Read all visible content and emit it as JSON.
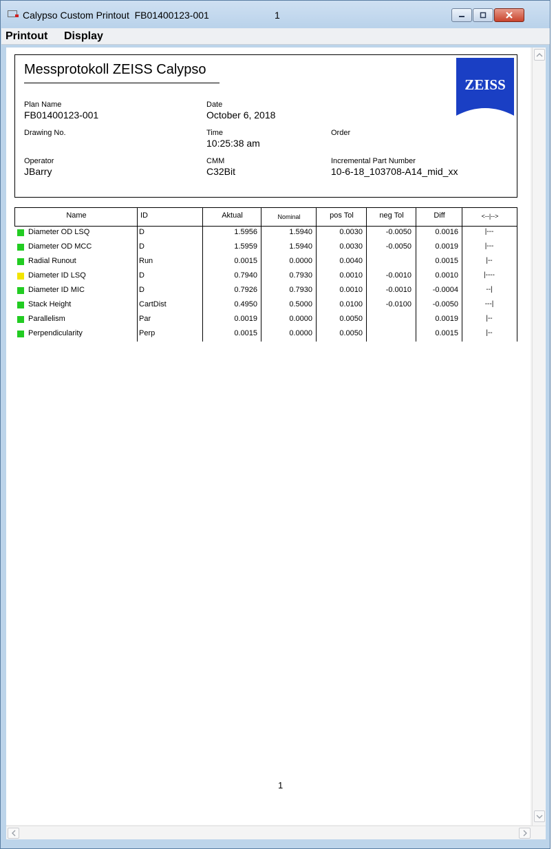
{
  "window": {
    "title": "Calypso Custom Printout  FB01400123-001",
    "title_number": "1"
  },
  "menu": {
    "items": [
      "Printout",
      "Display"
    ]
  },
  "report": {
    "title": "Messprotokoll  ZEISS  Calypso",
    "logo_text": "ZEISS",
    "fields": {
      "plan_name": {
        "label": "Plan Name",
        "value": "FB01400123-001"
      },
      "date": {
        "label": "Date",
        "value": "October 6, 2018"
      },
      "drawing_no": {
        "label": "Drawing No.",
        "value": ""
      },
      "time": {
        "label": "Time",
        "value": "10:25:38 am"
      },
      "order": {
        "label": "Order",
        "value": ""
      },
      "operator": {
        "label": "Operator",
        "value": "JBarry"
      },
      "cmm": {
        "label": "CMM",
        "value": "C32Bit"
      },
      "incremental": {
        "label": "Incremental Part Number",
        "value": "10-6-18_103708-A14_mid_xx"
      }
    }
  },
  "table": {
    "columns": [
      "Name",
      "ID",
      "Aktual",
      "Nominal",
      "pos Tol",
      "neg Tol",
      "Diff",
      "<--|-->"
    ],
    "rows": [
      {
        "status": "#22cc22",
        "name": "Diameter OD LSQ",
        "id": "D",
        "aktual": "1.5956",
        "nominal": "1.5940",
        "pos_tol": "0.0030",
        "neg_tol": "-0.0050",
        "diff": "0.0016",
        "dev": "|---"
      },
      {
        "status": "#22cc22",
        "name": "Diameter OD MCC",
        "id": "D",
        "aktual": "1.5959",
        "nominal": "1.5940",
        "pos_tol": "0.0030",
        "neg_tol": "-0.0050",
        "diff": "0.0019",
        "dev": "|---"
      },
      {
        "status": "#22cc22",
        "name": "Radial Runout",
        "id": "Run",
        "aktual": "0.0015",
        "nominal": "0.0000",
        "pos_tol": "0.0040",
        "neg_tol": "",
        "diff": "0.0015",
        "dev": "|--"
      },
      {
        "status": "#f2e400",
        "name": "Diameter ID LSQ",
        "id": "D",
        "aktual": "0.7940",
        "nominal": "0.7930",
        "pos_tol": "0.0010",
        "neg_tol": "-0.0010",
        "diff": "0.0010",
        "dev": "|----"
      },
      {
        "status": "#22cc22",
        "name": "Diameter ID MIC",
        "id": "D",
        "aktual": "0.7926",
        "nominal": "0.7930",
        "pos_tol": "0.0010",
        "neg_tol": "-0.0010",
        "diff": "-0.0004",
        "dev": "--|"
      },
      {
        "status": "#22cc22",
        "name": "Stack Height",
        "id": "CartDist",
        "aktual": "0.4950",
        "nominal": "0.5000",
        "pos_tol": "0.0100",
        "neg_tol": "-0.0100",
        "diff": "-0.0050",
        "dev": "---|"
      },
      {
        "status": "#22cc22",
        "name": "Parallelism",
        "id": "Par",
        "aktual": "0.0019",
        "nominal": "0.0000",
        "pos_tol": "0.0050",
        "neg_tol": "",
        "diff": "0.0019",
        "dev": "|--"
      },
      {
        "status": "#22cc22",
        "name": "Perpendicularity",
        "id": "Perp",
        "aktual": "0.0015",
        "nominal": "0.0000",
        "pos_tol": "0.0050",
        "neg_tol": "",
        "diff": "0.0015",
        "dev": "|--"
      }
    ]
  },
  "footer": {
    "page_number": "1"
  },
  "colors": {
    "zeiss_blue": "#1a3fc4",
    "ok": "#22cc22",
    "warn": "#f2e400"
  }
}
